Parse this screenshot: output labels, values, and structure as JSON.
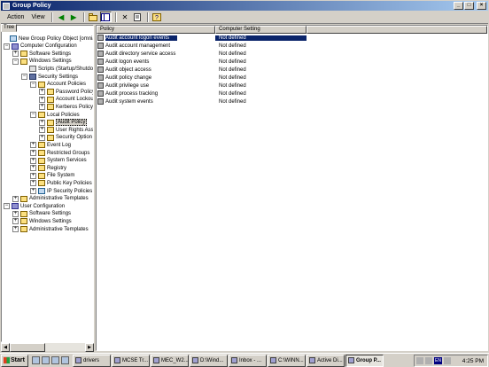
{
  "window": {
    "title": "Group Policy",
    "buttons": [
      "_",
      "□",
      "×"
    ]
  },
  "menu": {
    "action": "Action",
    "view": "View"
  },
  "tree_tab": "Tree",
  "tree": [
    {
      "label": "New Group Policy Object [omniasig",
      "icon": "gpo",
      "indent": 0,
      "expander": ""
    },
    {
      "label": "Computer Configuration",
      "icon": "comp",
      "indent": 1,
      "expander": "−"
    },
    {
      "label": "Software Settings",
      "icon": "folder",
      "indent": 2,
      "expander": "+"
    },
    {
      "label": "Windows Settings",
      "icon": "folder",
      "indent": 2,
      "expander": "−"
    },
    {
      "label": "Scripts (Startup/Shutdo",
      "icon": "doc",
      "indent": 3,
      "expander": ""
    },
    {
      "label": "Security Settings",
      "icon": "sec",
      "indent": 3,
      "expander": "−"
    },
    {
      "label": "Account Policies",
      "icon": "folder",
      "indent": 4,
      "expander": "−"
    },
    {
      "label": "Password Policy",
      "icon": "folder",
      "indent": 5,
      "expander": "+"
    },
    {
      "label": "Account Lockou",
      "icon": "folder",
      "indent": 5,
      "expander": "+"
    },
    {
      "label": "Kerberos Policy",
      "icon": "folder",
      "indent": 5,
      "expander": "+"
    },
    {
      "label": "Local Policies",
      "icon": "folder",
      "indent": 4,
      "expander": "−"
    },
    {
      "label": "Audit Policy",
      "icon": "folder",
      "indent": 5,
      "expander": "+",
      "selected": true
    },
    {
      "label": "User Rights Ass",
      "icon": "folder",
      "indent": 5,
      "expander": "+"
    },
    {
      "label": "Security Option",
      "icon": "folder",
      "indent": 5,
      "expander": "+"
    },
    {
      "label": "Event Log",
      "icon": "folder",
      "indent": 4,
      "expander": "+"
    },
    {
      "label": "Restricted Groups",
      "icon": "folder",
      "indent": 4,
      "expander": "+"
    },
    {
      "label": "System Services",
      "icon": "folder",
      "indent": 4,
      "expander": "+"
    },
    {
      "label": "Registry",
      "icon": "folder",
      "indent": 4,
      "expander": "+"
    },
    {
      "label": "File System",
      "icon": "folder",
      "indent": 4,
      "expander": "+"
    },
    {
      "label": "Public Key Policies",
      "icon": "folder",
      "indent": 4,
      "expander": "+"
    },
    {
      "label": "IP Security Policies o",
      "icon": "gpo",
      "indent": 4,
      "expander": "+"
    },
    {
      "label": "Administrative Templates",
      "icon": "folder",
      "indent": 2,
      "expander": "+"
    },
    {
      "label": "User Configuration",
      "icon": "comp",
      "indent": 1,
      "expander": "−"
    },
    {
      "label": "Software Settings",
      "icon": "folder",
      "indent": 2,
      "expander": "+"
    },
    {
      "label": "Windows Settings",
      "icon": "folder",
      "indent": 2,
      "expander": "+"
    },
    {
      "label": "Administrative Templates",
      "icon": "folder",
      "indent": 2,
      "expander": "+"
    }
  ],
  "list": {
    "columns": [
      "Policy",
      "Computer Setting"
    ],
    "rows": [
      {
        "policy": "Audit account logon events",
        "setting": "Not defined",
        "selected": true
      },
      {
        "policy": "Audit account management",
        "setting": "Not defined"
      },
      {
        "policy": "Audit directory service access",
        "setting": "Not defined"
      },
      {
        "policy": "Audit logon events",
        "setting": "Not defined"
      },
      {
        "policy": "Audit object access",
        "setting": "Not defined"
      },
      {
        "policy": "Audit policy change",
        "setting": "Not defined"
      },
      {
        "policy": "Audit privilege use",
        "setting": "Not defined"
      },
      {
        "policy": "Audit process tracking",
        "setting": "Not defined"
      },
      {
        "policy": "Audit system events",
        "setting": "Not defined"
      }
    ]
  },
  "taskbar": {
    "start": "Start",
    "tasks": [
      {
        "label": "drivers"
      },
      {
        "label": "MCSE Tr..."
      },
      {
        "label": "MEC_W2..."
      },
      {
        "label": "D:\\Wind..."
      },
      {
        "label": "Inbox - ..."
      },
      {
        "label": "C:\\WINN..."
      },
      {
        "label": "Active Di..."
      },
      {
        "label": "Group P...",
        "active": true
      }
    ],
    "lang": "EN",
    "clock": "4:25 PM"
  }
}
